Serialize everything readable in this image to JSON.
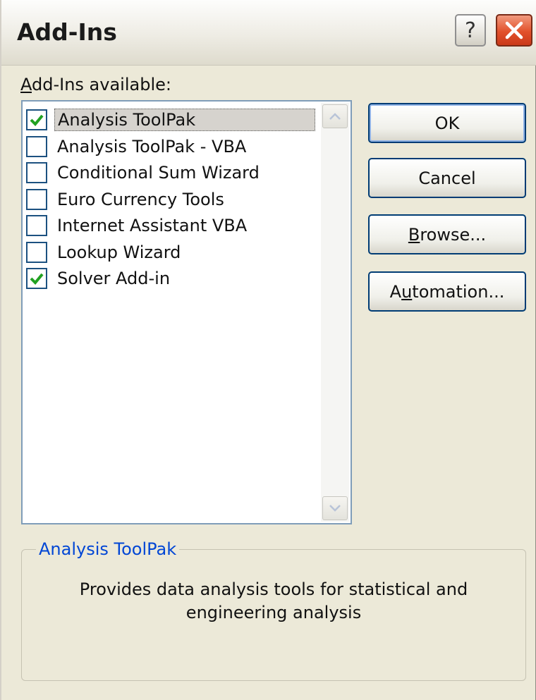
{
  "window": {
    "title": "Add-Ins",
    "help_label": "?"
  },
  "available_label": {
    "prefix": "A",
    "rest": "dd-Ins available:"
  },
  "addins": [
    {
      "label": "Analysis ToolPak",
      "checked": true,
      "selected": true
    },
    {
      "label": "Analysis ToolPak - VBA",
      "checked": false,
      "selected": false
    },
    {
      "label": "Conditional Sum Wizard",
      "checked": false,
      "selected": false
    },
    {
      "label": "Euro Currency Tools",
      "checked": false,
      "selected": false
    },
    {
      "label": "Internet Assistant VBA",
      "checked": false,
      "selected": false
    },
    {
      "label": "Lookup Wizard",
      "checked": false,
      "selected": false
    },
    {
      "label": "Solver Add-in",
      "checked": true,
      "selected": false
    }
  ],
  "buttons": {
    "ok": "OK",
    "cancel": "Cancel",
    "browse": {
      "mnemonic": "B",
      "rest": "rowse..."
    },
    "automation": {
      "pre": "A",
      "mnemonic": "u",
      "rest": "tomation..."
    }
  },
  "details": {
    "title": "Analysis ToolPak",
    "description": "Provides data analysis tools for statistical and engineering analysis"
  },
  "colors": {
    "check": "#21a121",
    "group_title": "#0046d5"
  },
  "icons": {
    "help": "question-mark",
    "close": "x",
    "scroll_up": "chevron-up",
    "scroll_down": "chevron-down",
    "check": "checkmark"
  }
}
